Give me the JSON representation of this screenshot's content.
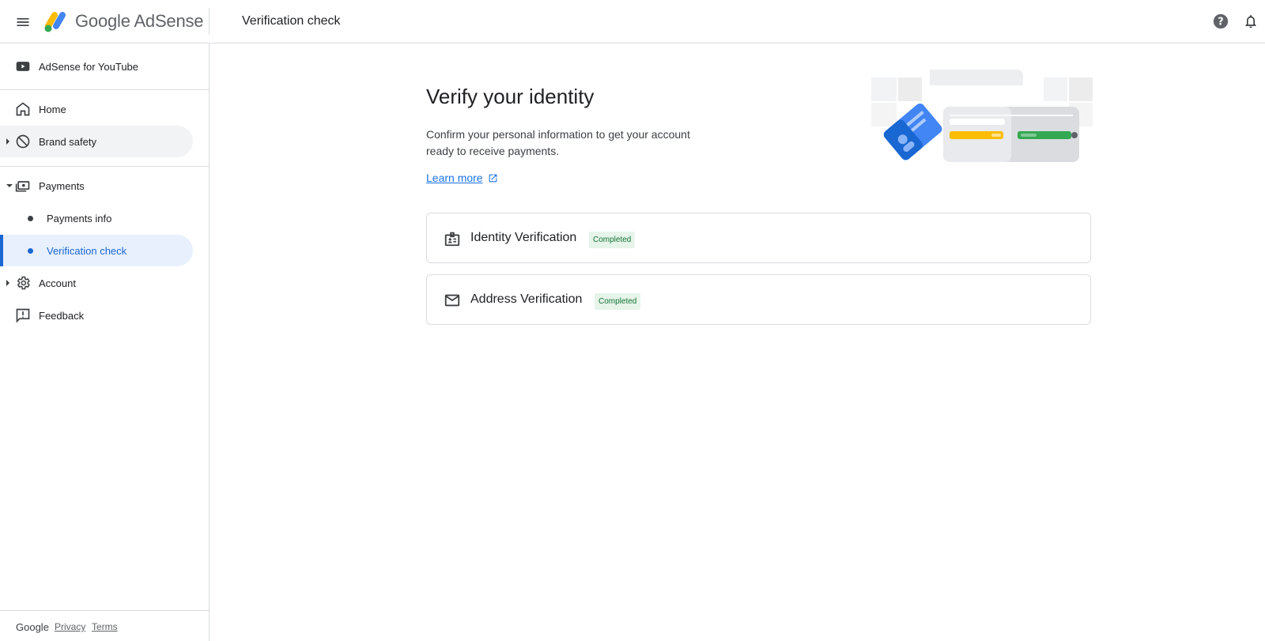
{
  "header": {
    "brand": "Google AdSense",
    "page_title": "Verification check"
  },
  "sidebar": {
    "top_item": "AdSense for YouTube",
    "items": [
      {
        "label": "Home"
      },
      {
        "label": "Brand safety"
      },
      {
        "label": "Payments"
      },
      {
        "label": "Payments info"
      },
      {
        "label": "Verification check"
      },
      {
        "label": "Account"
      },
      {
        "label": "Feedback"
      }
    ],
    "footer": {
      "google": "Google",
      "privacy": "Privacy",
      "terms": "Terms"
    }
  },
  "main": {
    "heading": "Verify your identity",
    "description": "Confirm your personal information to get your account ready to receive payments.",
    "learn_more": "Learn more",
    "cards": [
      {
        "title": "Identity Verification",
        "status": "Completed"
      },
      {
        "title": "Address Verification",
        "status": "Completed"
      }
    ]
  },
  "colors": {
    "accent": "#1967d2",
    "selected_bg": "#e8f0fe",
    "status_green_bg": "#e6f4ea",
    "status_green_text": "#137333"
  },
  "icons": [
    "menu-icon",
    "adsense-logo-icon",
    "help-icon",
    "bell-icon",
    "youtube-icon",
    "home-icon",
    "block-icon",
    "payments-icon",
    "gear-icon",
    "feedback-icon",
    "external-link-icon",
    "id-badge-icon",
    "mail-icon"
  ]
}
